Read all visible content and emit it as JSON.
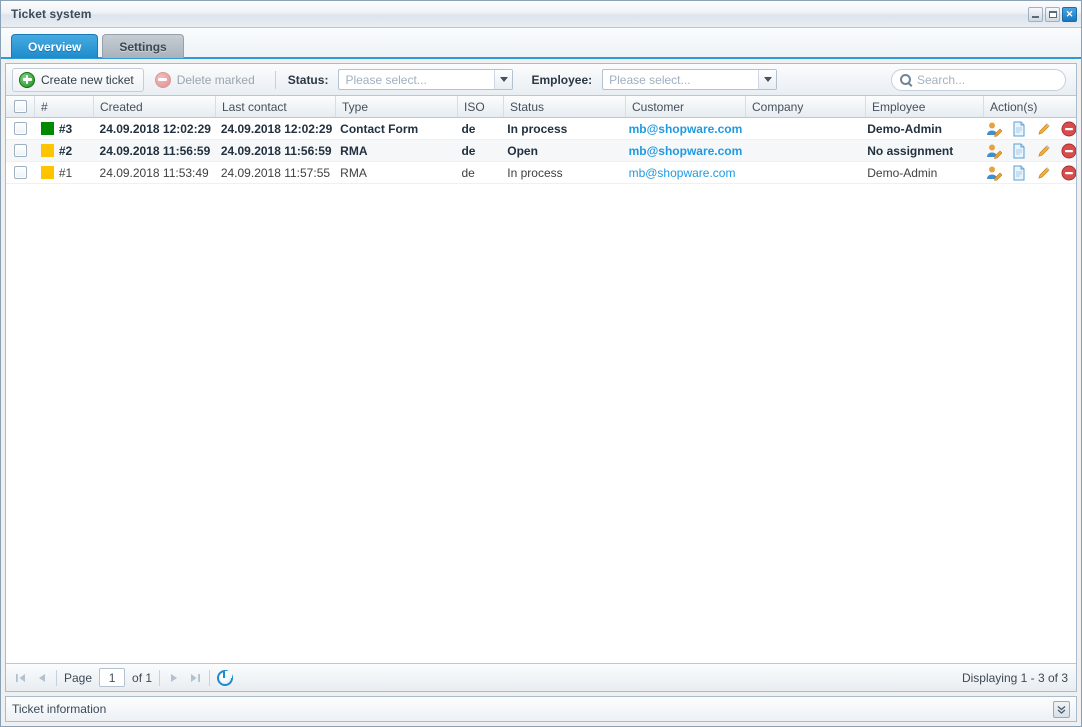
{
  "window": {
    "title": "Ticket system",
    "controls": {
      "minimize": "minimize-button",
      "maximize": "maximize-button",
      "close": "✕"
    }
  },
  "tabs": [
    {
      "label": "Overview",
      "active": true
    },
    {
      "label": "Settings",
      "active": false
    }
  ],
  "toolbar": {
    "create_label": "Create new ticket",
    "delete_label": "Delete marked",
    "status_label": "Status:",
    "status_placeholder": "Please select...",
    "employee_label": "Employee:",
    "employee_placeholder": "Please select...",
    "search_placeholder": "Search..."
  },
  "grid": {
    "columns": [
      "#",
      "Created",
      "Last contact",
      "Type",
      "ISO",
      "Status",
      "Customer",
      "Company",
      "Employee",
      "Action(s)"
    ],
    "rows": [
      {
        "id": "#3",
        "color": "#008a00",
        "created": "24.09.2018 12:02:29",
        "last_contact": "24.09.2018 12:02:29",
        "type": "Contact Form",
        "iso": "de",
        "status": "In process",
        "customer": "mb@shopware.com",
        "company": "",
        "employee": "Demo-Admin",
        "unread": true
      },
      {
        "id": "#2",
        "color": "#ffc400",
        "created": "24.09.2018 11:56:59",
        "last_contact": "24.09.2018 11:56:59",
        "type": "RMA",
        "iso": "de",
        "status": "Open",
        "customer": "mb@shopware.com",
        "company": "",
        "employee": "No assignment",
        "unread": true
      },
      {
        "id": "#1",
        "color": "#ffc400",
        "created": "24.09.2018 11:53:49",
        "last_contact": "24.09.2018 11:57:55",
        "type": "RMA",
        "iso": "de",
        "status": "In process",
        "customer": "mb@shopware.com",
        "company": "",
        "employee": "Demo-Admin",
        "unread": false
      }
    ],
    "action_icons": [
      "assign-user-icon",
      "view-document-icon",
      "edit-icon",
      "delete-icon"
    ]
  },
  "pager": {
    "page_label": "Page",
    "page_value": "1",
    "of_label": "of 1",
    "displaying": "Displaying 1 - 3 of 3"
  },
  "info_panel": {
    "title": "Ticket information",
    "collapse_glyph": "⌄⌄"
  },
  "colors": {
    "accent": "#1f8ccb",
    "link": "#1f9ae0",
    "status_green": "#008a00",
    "status_amber": "#ffc400",
    "delete_red": "#cc3333"
  }
}
